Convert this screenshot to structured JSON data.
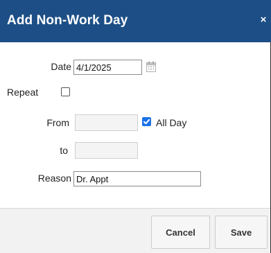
{
  "dialog": {
    "title": "Add Non-Work Day",
    "close_glyph": "×"
  },
  "form": {
    "date_label": "Date",
    "date_value": "4/1/2025",
    "repeat_label": "Repeat",
    "repeat_checked": false,
    "from_label": "From",
    "from_value": "",
    "all_day_label": "All Day",
    "all_day_checked": true,
    "to_label": "to",
    "to_value": "",
    "reason_label": "Reason",
    "reason_value": "Dr. Appt"
  },
  "footer": {
    "cancel_label": "Cancel",
    "save_label": "Save"
  },
  "colors": {
    "titlebar": "#1d4f86",
    "checkbox_checked": "#1a73e8"
  },
  "icons": {
    "calendar": "calendar-icon",
    "close": "close-icon",
    "check": "check-icon"
  }
}
